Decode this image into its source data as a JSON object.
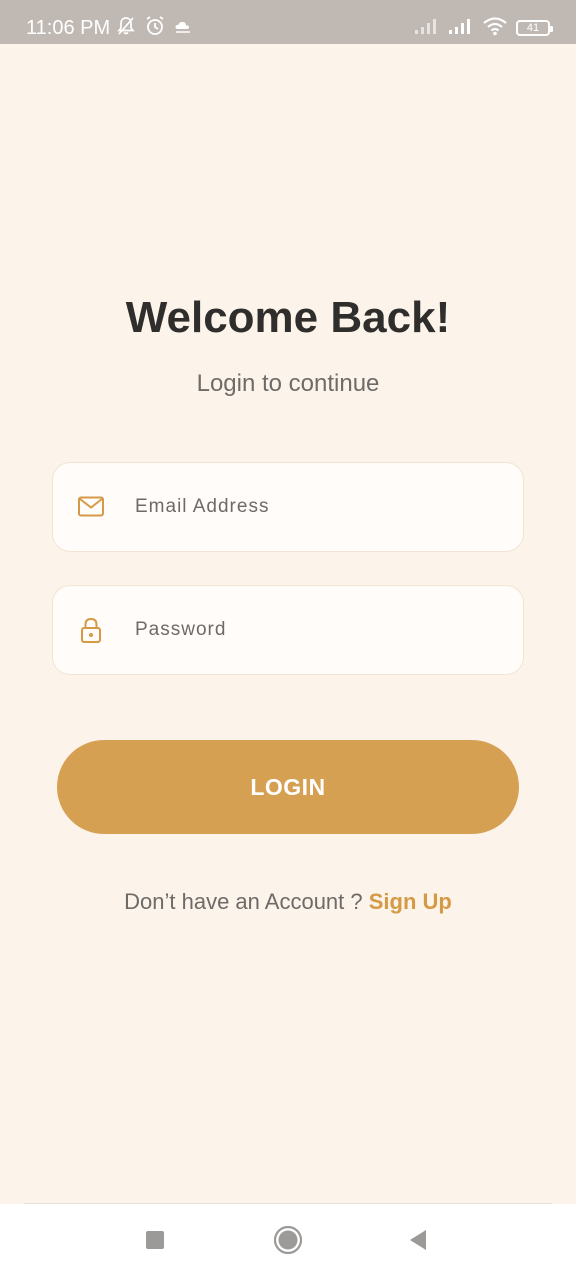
{
  "status_bar": {
    "time": "11:06 PM",
    "battery_level": "41",
    "icons_left": [
      "bell-off-icon",
      "alarm-icon",
      "cloud-icon"
    ],
    "icons_right": [
      "signal-icon",
      "signal-icon",
      "wifi-icon",
      "battery-icon"
    ]
  },
  "header": {
    "title": "Welcome Back!",
    "subtitle": "Login to continue"
  },
  "form": {
    "email": {
      "placeholder": "Email Address",
      "value": "",
      "icon": "mail-icon"
    },
    "password": {
      "placeholder": "Password",
      "value": "",
      "icon": "lock-icon"
    },
    "login_label": "LOGIN"
  },
  "signup": {
    "prompt": "Don’t have an Account ? ",
    "link_label": "Sign Up"
  },
  "nav_bar": {
    "buttons": [
      "recents-icon",
      "home-icon",
      "back-icon"
    ]
  },
  "colors": {
    "background": "#fcf4ea",
    "accent": "#d6a052",
    "title": "#2f2e2c",
    "muted_text": "#6d6a67",
    "status_bar": "#c0b8b2"
  }
}
